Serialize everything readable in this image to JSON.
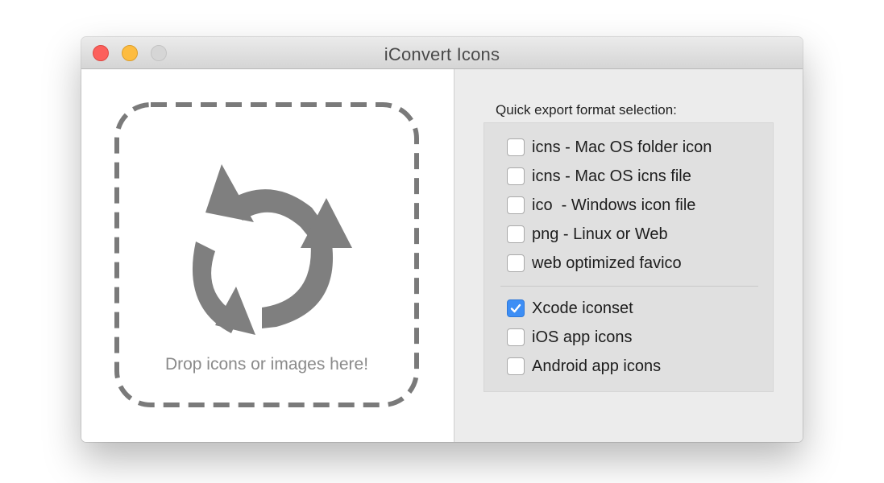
{
  "window": {
    "title": "iConvert Icons"
  },
  "dropzone": {
    "icon": "refresh-icon",
    "text": "Drop icons or images here!"
  },
  "export": {
    "label": "Quick export format selection:",
    "options": [
      {
        "label": "icns - Mac OS folder icon",
        "checked": false
      },
      {
        "label": "icns - Mac OS icns file",
        "checked": false
      },
      {
        "label": "ico  - Windows icon file",
        "checked": false
      },
      {
        "label": "png - Linux or Web",
        "checked": false
      },
      {
        "label": "web optimized favico",
        "checked": false
      },
      {
        "label": "Xcode iconset",
        "checked": true
      },
      {
        "label": "iOS app icons",
        "checked": false
      },
      {
        "label": "Android app icons",
        "checked": false
      }
    ]
  },
  "colors": {
    "close": "#fc605c",
    "minimize": "#fdbc40",
    "zoom": "#d6d6d6",
    "checkbox_checked": "#3d8ef5",
    "icon_gray": "#7f7f7f"
  }
}
